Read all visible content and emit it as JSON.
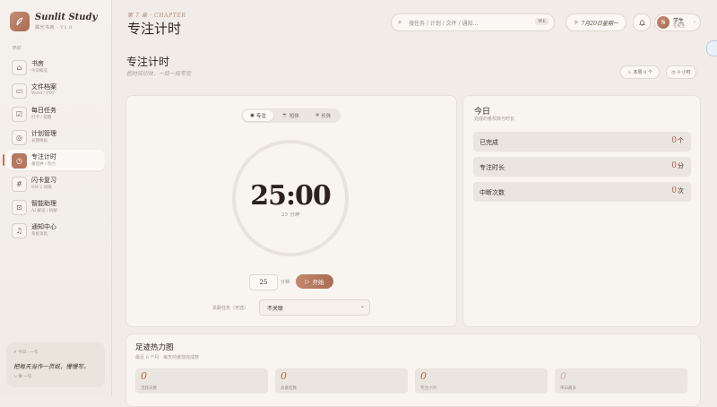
{
  "sidebar": {
    "brand": "Sunlit Study",
    "brand_sub": "橘光书房 · V1.0",
    "nav_header": "导航",
    "items": [
      {
        "label": "书房",
        "sub": "今日概览",
        "icon": "home-icon"
      },
      {
        "label": "文件档案",
        "sub": "Word / PDF",
        "icon": "folder-icon"
      },
      {
        "label": "每日任务",
        "sub": "打卡 / 提醒",
        "icon": "check-square-icon"
      },
      {
        "label": "计划管理",
        "sub": "长期目标",
        "icon": "target-icon"
      },
      {
        "label": "专注计时",
        "sub": "番茄钟 / 热力",
        "icon": "timer-icon",
        "active": true
      },
      {
        "label": "闪卡复习",
        "sub": "SM-2 间隔",
        "icon": "hash-icon"
      },
      {
        "label": "智能助理",
        "sub": "AI 解读 / 拆解",
        "icon": "robot-icon"
      },
      {
        "label": "通知中心",
        "sub": "系统消息",
        "icon": "bell-icon"
      }
    ],
    "quote": {
      "header": "今日 · 一句",
      "text": "把每天当作一页纸，慢慢写。",
      "button": "换 一句"
    }
  },
  "topbar": {
    "chapter": "第 7 章 · CHAPTER",
    "title": "专注计时",
    "search_placeholder": "搜任务 / 计划 / 文件 / 通知…",
    "search_shortcut": "⌘K",
    "date": "7月20日星期一",
    "user_initial": "S",
    "user_name": "学生",
    "user_role": "在校生"
  },
  "page": {
    "title": "专注计时",
    "subtitle": "把时间切块，一段一段写完",
    "badge_week": "本周 0 个",
    "badge_hours": "0 小时"
  },
  "timer": {
    "modes": [
      "专注",
      "短休",
      "长休"
    ],
    "selected_mode": "专注",
    "time": "25:00",
    "time_sub": "25 分钟",
    "minutes_value": "25",
    "minutes_unit": "分钟",
    "start_label": "开始",
    "link_label": "关联任务（可选）",
    "link_value": "不关联"
  },
  "today": {
    "title": "今日",
    "subtitle": "完成的番茄数与时长",
    "stats": [
      {
        "label": "已完成",
        "value": "0",
        "unit": "个"
      },
      {
        "label": "专注时长",
        "value": "0",
        "unit": "分"
      },
      {
        "label": "中断次数",
        "value": "0",
        "unit": "次"
      }
    ]
  },
  "heatmap": {
    "title": "足迹热力图",
    "subtitle": "最近 6 个月 · 每天的番茄完成数",
    "stats": [
      {
        "value": "0",
        "label": "活跃天数"
      },
      {
        "value": "0",
        "label": "总番茄数"
      },
      {
        "value": "0",
        "label": "专注小时"
      },
      {
        "value": "0",
        "label": "单日最多"
      }
    ]
  },
  "colors": {
    "accent": "#b6785e",
    "background": "#f1ece7",
    "card": "#f8f4f0"
  }
}
